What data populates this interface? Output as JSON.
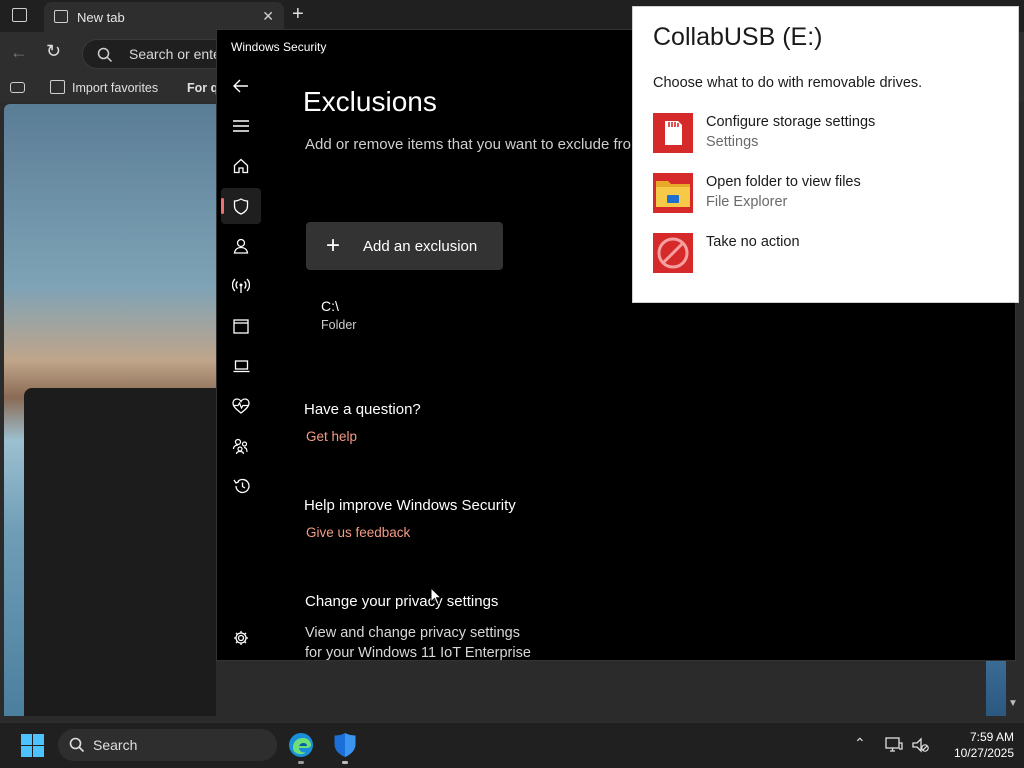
{
  "browser": {
    "tab_title": "New tab",
    "address_placeholder": "Search or ente",
    "favorites": {
      "import_label": "Import favorites",
      "for_label": "For q"
    }
  },
  "window": {
    "title": "Windows Security"
  },
  "exclusions": {
    "title": "Exclusions",
    "subtitle": "Add or remove items that you want to exclude fro",
    "add_button": "Add an exclusion",
    "items": [
      {
        "path": "C:\\",
        "type": "Folder"
      }
    ]
  },
  "help": {
    "question_heading": "Have a question?",
    "get_help": "Get help",
    "improve_heading": "Help improve Windows Security",
    "feedback": "Give us feedback",
    "privacy_heading": "Change your privacy settings",
    "privacy_text_1": "View and change privacy settings",
    "privacy_text_2": "for your Windows 11 IoT Enterprise"
  },
  "autoplay": {
    "title": "CollabUSB (E:)",
    "subtitle": "Choose what to do with removable drives.",
    "options": [
      {
        "label": "Configure storage settings",
        "sub": "Settings",
        "icon": "sd-card-icon"
      },
      {
        "label": "Open folder to view files",
        "sub": "File Explorer",
        "icon": "folder-icon"
      },
      {
        "label": "Take no action",
        "sub": "",
        "icon": "no-action-icon"
      }
    ]
  },
  "taskbar": {
    "search_label": "Search",
    "time": "7:59 AM",
    "date": "10/27/2025"
  },
  "colors": {
    "accent_link": "#f59a85",
    "nav_selected_marker": "#f07070",
    "autoplay_icon_red": "#d62a2a"
  }
}
